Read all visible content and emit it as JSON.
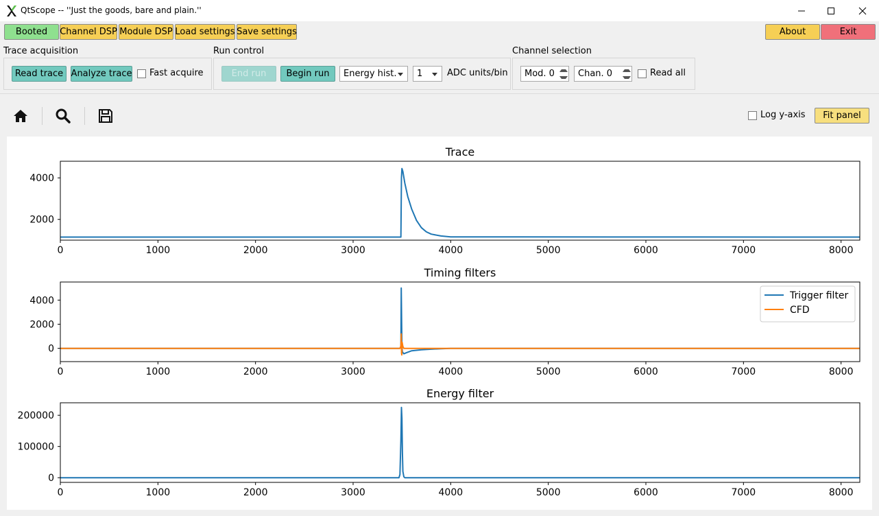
{
  "window": {
    "title": "QtScope -- ''Just the goods, bare and plain.''",
    "icon": "x-logo-icon"
  },
  "toolbar": {
    "booted": "Booted",
    "channel_dsp": "Channel DSP",
    "module_dsp": "Module DSP",
    "load_settings": "Load settings",
    "save_settings": "Save settings",
    "about": "About",
    "exit": "Exit"
  },
  "trace_acquisition": {
    "label": "Trace acquisition",
    "read_trace": "Read trace",
    "analyze_trace": "Analyze trace",
    "fast_acquire": "Fast acquire",
    "fast_acquire_checked": false
  },
  "run_control": {
    "label": "Run control",
    "end_run": "End run",
    "begin_run": "Begin run",
    "run_type": "Energy hist.",
    "bin_value": "1",
    "bin_unit": "ADC units/bin"
  },
  "channel_selection": {
    "label": "Channel selection",
    "module": "Mod. 0",
    "channel": "Chan. 0",
    "read_all": "Read all",
    "read_all_checked": false
  },
  "plot_toolbar": {
    "home_icon": "home-icon",
    "zoom_icon": "zoom-icon",
    "save_icon": "save-icon",
    "log_y_axis": "Log y-axis",
    "log_y_checked": false,
    "fit_panel": "Fit panel"
  },
  "colors": {
    "blue": "#1f77b4",
    "orange": "#ff7f0e",
    "green_button": "#8fe08f",
    "yellow_button": "#f6cf55",
    "red_button": "#f0707a",
    "teal_button": "#72c9be"
  },
  "chart_data": [
    {
      "type": "line",
      "title": "Trace",
      "xlim": [
        0,
        8192
      ],
      "ylim": [
        1000,
        4800
      ],
      "xticks": [
        0,
        1000,
        2000,
        3000,
        4000,
        5000,
        6000,
        7000,
        8000
      ],
      "yticks": [
        2000,
        4000
      ],
      "grid": false,
      "series": [
        {
          "name": "",
          "color": "#1f77b4",
          "x": [
            0,
            3490,
            3495,
            3500,
            3510,
            3530,
            3560,
            3600,
            3650,
            3700,
            3750,
            3800,
            3900,
            4000,
            8192
          ],
          "y": [
            1150,
            1150,
            4000,
            4450,
            4300,
            3750,
            3100,
            2500,
            1950,
            1600,
            1400,
            1290,
            1200,
            1160,
            1150
          ]
        }
      ]
    },
    {
      "type": "line",
      "title": "Timing filters",
      "xlim": [
        0,
        8192
      ],
      "ylim": [
        -1100,
        5500
      ],
      "xticks": [
        0,
        1000,
        2000,
        3000,
        4000,
        5000,
        6000,
        7000,
        8000
      ],
      "yticks": [
        0,
        2000,
        4000
      ],
      "grid": false,
      "legend": "top-right",
      "series": [
        {
          "name": "Trigger filter",
          "color": "#1f77b4",
          "x": [
            0,
            3480,
            3490,
            3493,
            3497,
            3500,
            3505,
            3520,
            3550,
            3600,
            3700,
            3800,
            3900,
            4000,
            8192
          ],
          "y": [
            0,
            0,
            100,
            5000,
            2500,
            200,
            -300,
            -450,
            -350,
            -200,
            -120,
            -70,
            -30,
            0,
            0
          ]
        },
        {
          "name": "CFD",
          "color": "#ff7f0e",
          "x": [
            0,
            3480,
            3490,
            3493,
            3496,
            3499,
            3502,
            3510,
            3520,
            3600,
            8192
          ],
          "y": [
            0,
            0,
            200,
            1200,
            -400,
            -550,
            500,
            150,
            0,
            0,
            0
          ]
        }
      ]
    },
    {
      "type": "line",
      "title": "Energy filter",
      "xlim": [
        0,
        8192
      ],
      "ylim": [
        -15000,
        240000
      ],
      "xticks": [
        0,
        1000,
        2000,
        3000,
        4000,
        5000,
        6000,
        7000,
        8000
      ],
      "yticks": [
        0,
        100000,
        200000
      ],
      "grid": false,
      "series": [
        {
          "name": "",
          "color": "#1f77b4",
          "x": [
            0,
            3470,
            3480,
            3490,
            3495,
            3500,
            3505,
            3510,
            3520,
            3530,
            8192
          ],
          "y": [
            0,
            0,
            10000,
            120000,
            225000,
            190000,
            80000,
            20000,
            3000,
            0,
            0
          ]
        }
      ]
    }
  ]
}
